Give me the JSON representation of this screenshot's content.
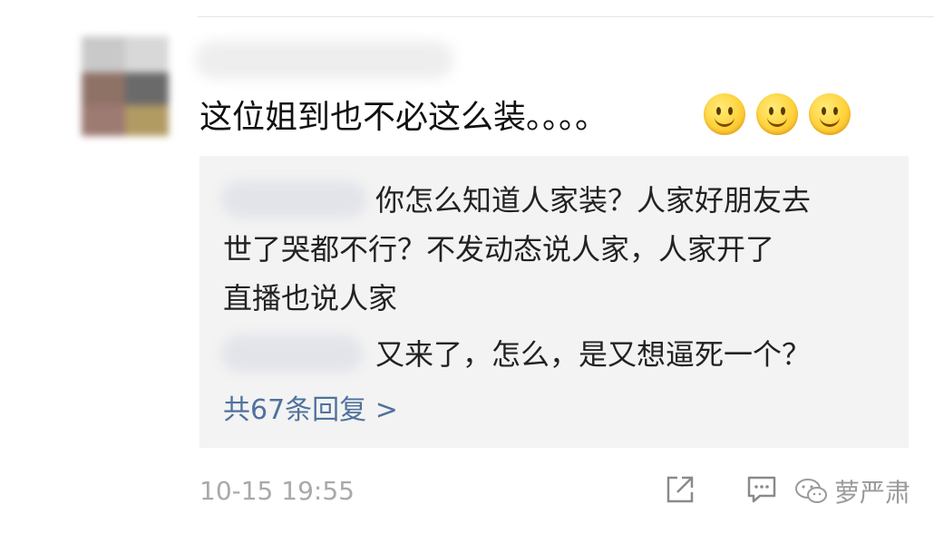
{
  "comment": {
    "text": "这位姐到也不必这么装。。。。",
    "emojis": [
      "smiley-face",
      "smiley-face",
      "smiley-face"
    ],
    "timestamp": "10-15 19:55"
  },
  "replies": [
    {
      "text_line1": "你怎么知道人家装？人家好朋友去",
      "text_line2": "世了哭都不行？不发动态说人家，人家开了",
      "text_line3": "直播也说人家"
    },
    {
      "text_line1": "又来了，怎么，是又想逼死一个？"
    }
  ],
  "more_replies": "共67条回复 >",
  "actions": {
    "share_icon": "share-icon",
    "comment_icon": "comment-icon"
  },
  "watermark": {
    "text": "萝严肃"
  },
  "colors": {
    "link": "#50729c",
    "reply_bg": "#f3f3f3",
    "timestamp": "#a9a9a9"
  }
}
